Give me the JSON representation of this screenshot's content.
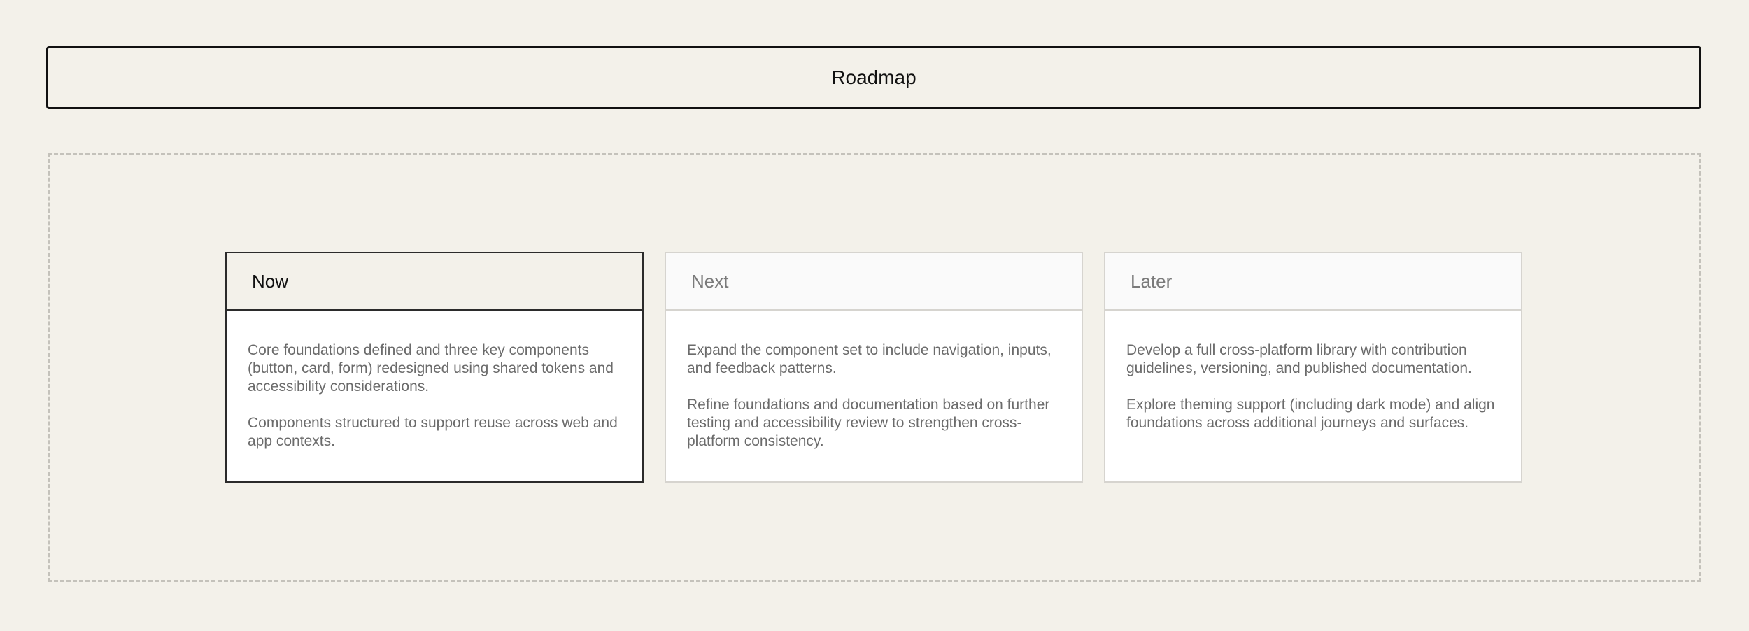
{
  "header": {
    "title": "Roadmap"
  },
  "columns": [
    {
      "label": "Now",
      "active": true,
      "paragraphs": [
        "Core foundations defined and three key components (button, card, form) redesigned using shared tokens and accessibility considerations.",
        "Components structured to support reuse across web and app contexts."
      ]
    },
    {
      "label": "Next",
      "active": false,
      "paragraphs": [
        "Expand the component set to include navigation, inputs, and feedback patterns.",
        "Refine foundations and documentation based on further testing and accessibility review to strengthen cross-platform consistency."
      ]
    },
    {
      "label": "Later",
      "active": false,
      "paragraphs": [
        "Develop a full cross-platform library with contribution guidelines, versioning, and published documentation.",
        "Explore theming support (including dark mode) and align foundations across additional journeys and surfaces."
      ]
    }
  ],
  "colors": {
    "background": "#f3f1ea",
    "active_border": "#2b2b2b",
    "inactive_border": "#d6d4cf",
    "body_text": "#6b6b6b"
  }
}
